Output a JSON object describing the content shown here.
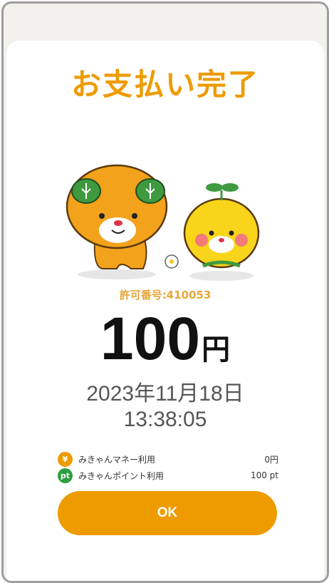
{
  "page": {
    "title": "お支払い完了"
  },
  "permit": {
    "label": "許可番号:410053"
  },
  "payment": {
    "amount": "100",
    "unit": "円",
    "date": "2023年11月18日",
    "time": "13:38:05"
  },
  "breakdown": [
    {
      "icon": "yen-icon",
      "badge": "¥",
      "color": "#ee9b00",
      "label": "みきゃんマネー利用",
      "value": "0円"
    },
    {
      "icon": "points-icon",
      "badge": "pt",
      "color": "#2e9e3e",
      "label": "みきゃんポイント利用",
      "value": "100 pt"
    }
  ],
  "actions": {
    "ok_label": "OK"
  },
  "colors": {
    "accent": "#ee9b00",
    "points": "#2e9e3e"
  }
}
